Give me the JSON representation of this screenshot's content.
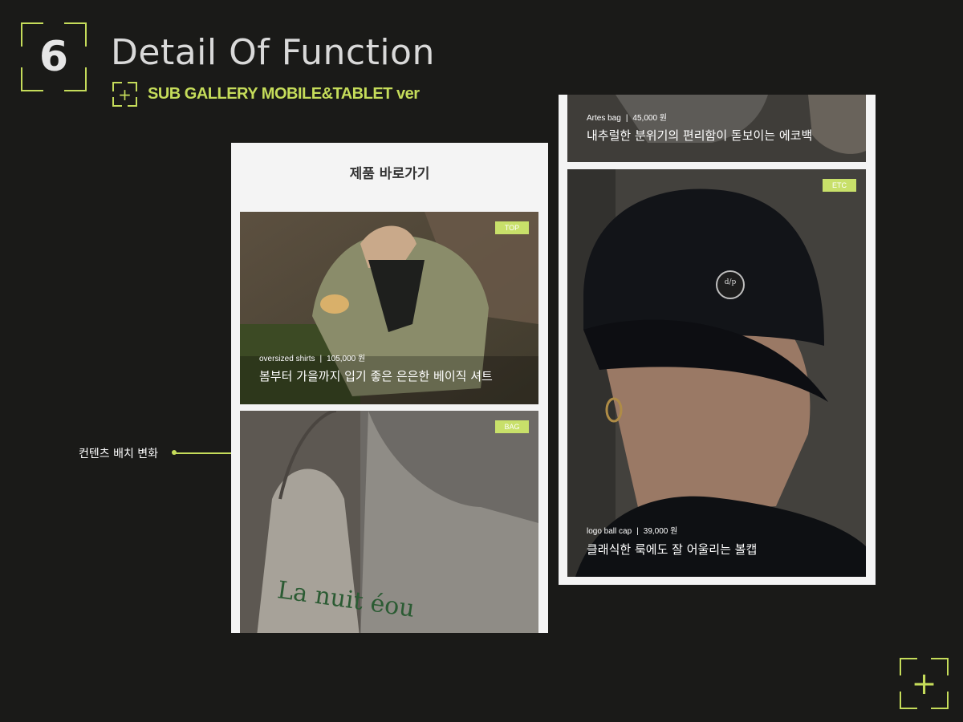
{
  "header": {
    "section_number": "6",
    "title": "Detail Of Function",
    "subtitle": "SUB GALLERY MOBILE&TABLET ver",
    "sub_plus": "+"
  },
  "annotation": {
    "label": "컨텐츠 배치 변화"
  },
  "mobile": {
    "heading": "제품 바로가기",
    "cards": [
      {
        "badge": "TOP",
        "name": "oversized shirts",
        "price": "105,000 원",
        "description": "봄부터 가을까지 입기 좋은 은은한 베이직 셔트"
      },
      {
        "badge": "BAG",
        "image_text": "La nuit éou"
      }
    ]
  },
  "tablet": {
    "cards": [
      {
        "name": "Artes bag",
        "price": "45,000 원",
        "description": "내추럴한 분위기의 편리함이 돋보이는 에코백"
      },
      {
        "badge": "ETC",
        "name": "logo ball cap",
        "price": "39,000 원",
        "description": "클래식한 룩에도 잘 어울리는 볼캡",
        "logo_text": "d/p"
      }
    ]
  },
  "corner_plus": "+",
  "colors": {
    "background": "#1a1a18",
    "accent": "#c5dc5a",
    "badge": "#c8e06a",
    "panel": "#f4f4f4"
  },
  "icons": {
    "sub_plus": "plus-icon",
    "corner_plus": "plus-icon"
  }
}
